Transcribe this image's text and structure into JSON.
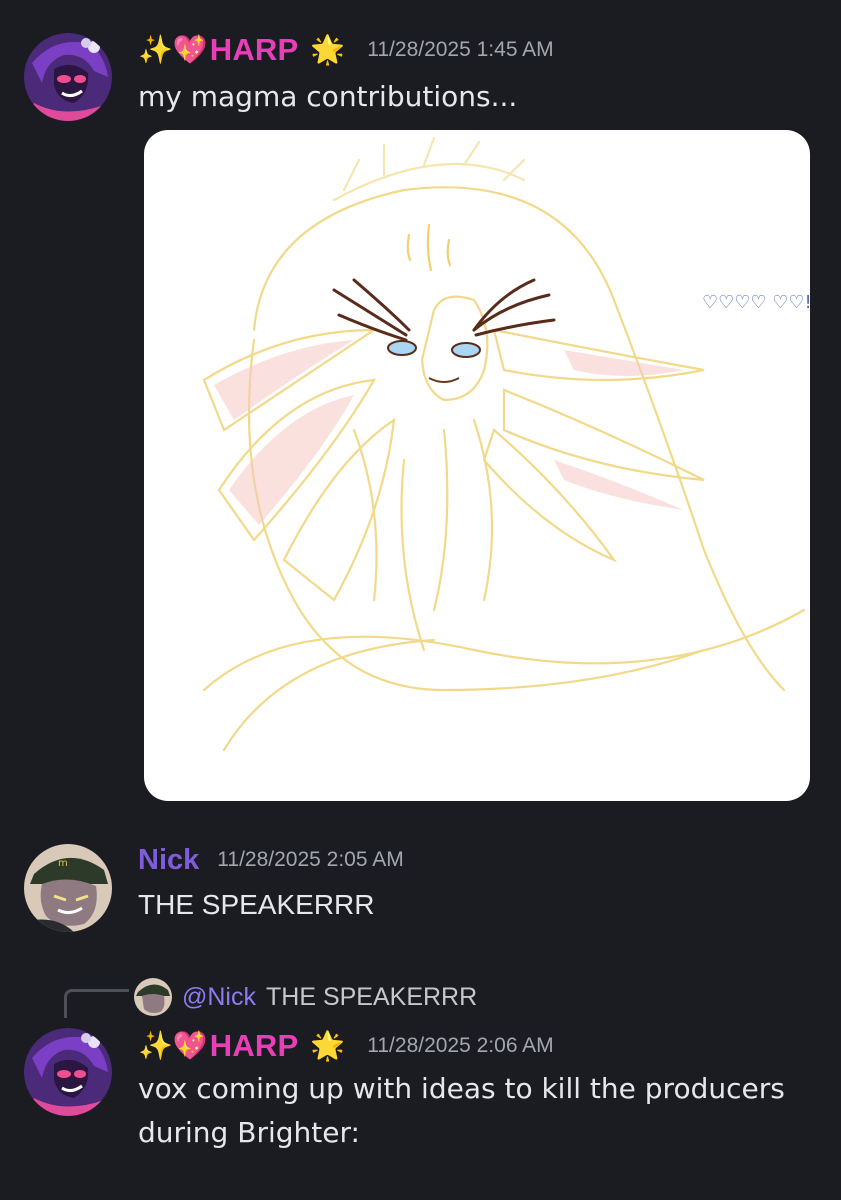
{
  "messages": [
    {
      "author": "HARP",
      "prefix_emoji": "✨💖",
      "suffix_emoji": "🌟",
      "timestamp": "11/28/2025 1:45 AM",
      "text": "my magma contributions...",
      "attachment": {
        "type": "image",
        "doodle_text": "♡♡♡♡ ♡♡!"
      }
    },
    {
      "author": "Nick",
      "timestamp": "11/28/2025 2:05 AM",
      "text": "THE SPEAKERRR"
    },
    {
      "reply_to": {
        "mention": "@Nick",
        "text": "THE SPEAKERRR"
      },
      "author": "HARP",
      "prefix_emoji": "✨💖",
      "suffix_emoji": "🌟",
      "timestamp": "11/28/2025 2:06 AM",
      "text_lines": [
        "vox coming up with ideas to kill the producers",
        "during Brighter:"
      ]
    }
  ],
  "colors": {
    "background": "#1b1c22",
    "harp_name": "#e83fb8",
    "nick_name": "#7e5cdb",
    "timestamp": "#a3a6b0",
    "message_text": "#e6e7ea",
    "mention": "#8e7bf0"
  }
}
